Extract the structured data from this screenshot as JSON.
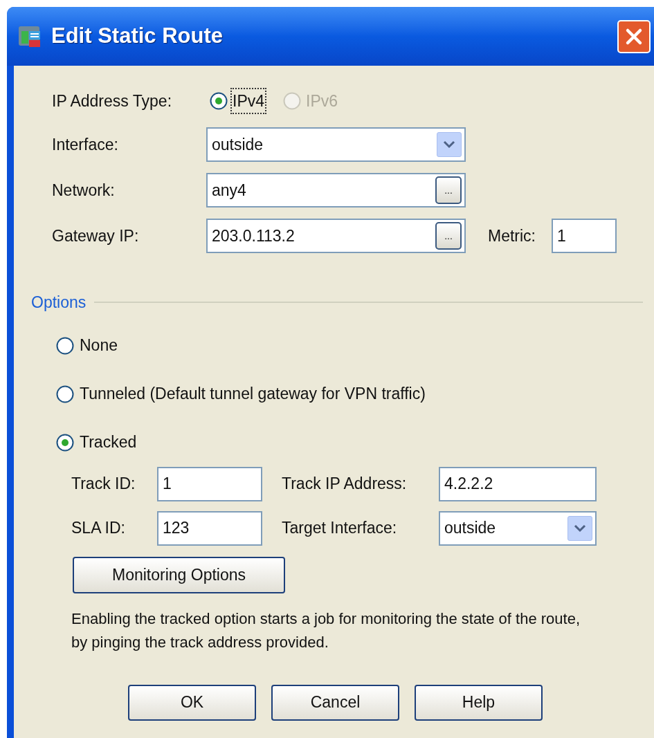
{
  "window": {
    "title": "Edit Static Route"
  },
  "ip_address_type": {
    "label": "IP Address Type:",
    "options": [
      {
        "label": "IPv4",
        "selected": true,
        "disabled": false,
        "focused": true
      },
      {
        "label": "IPv6",
        "selected": false,
        "disabled": true,
        "focused": false
      }
    ]
  },
  "fields": [
    {
      "kind": "dropdown",
      "label": "Interface:",
      "value": "outside"
    },
    {
      "kind": "browse",
      "label": "Network:",
      "value": "any4",
      "button_label": "..."
    },
    {
      "kind": "browse",
      "label": "Gateway IP:",
      "value": "203.0.113.2",
      "button_label": "...",
      "extra": {
        "label": "Metric:",
        "value": "1"
      }
    }
  ],
  "options": {
    "legend": "Options",
    "choices": [
      {
        "label": "None",
        "selected": false
      },
      {
        "label": "Tunneled (Default tunnel gateway for VPN traffic)",
        "selected": false
      },
      {
        "label": "Tracked",
        "selected": true
      }
    ]
  },
  "tracking": {
    "fields": [
      {
        "kind": "text",
        "label": "Track ID:",
        "value": "1"
      },
      {
        "kind": "text",
        "label": "Track IP Address:",
        "value": "4.2.2.2"
      },
      {
        "kind": "text",
        "label": "SLA ID:",
        "value": "123"
      },
      {
        "kind": "dropdown",
        "label": "Target Interface:",
        "value": "outside"
      }
    ],
    "monitoring_button": "Monitoring Options",
    "description": "Enabling the tracked option starts a job for monitoring the state of the route, by pinging the track address provided."
  },
  "buttons": [
    "OK",
    "Cancel",
    "Help"
  ]
}
